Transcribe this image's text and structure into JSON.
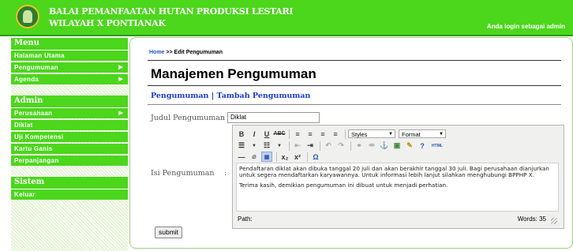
{
  "header": {
    "org_line1": "BALAI PEMANFAATAN HUTAN PRODUKSI LESTARI",
    "org_line2": "WILAYAH X PONTIANAK",
    "login_status": "Anda login sebagai admin"
  },
  "sidebar": {
    "sections": [
      {
        "title": "Menu",
        "items": [
          {
            "label": "Halaman Utama",
            "submenu": false
          },
          {
            "label": "Pengumuman",
            "submenu": true
          },
          {
            "label": "Agenda",
            "submenu": true
          }
        ]
      },
      {
        "title": "Admin",
        "items": [
          {
            "label": "Perusahaan",
            "submenu": true
          },
          {
            "label": "Diklat",
            "submenu": false
          },
          {
            "label": "Uji Kompetensi",
            "submenu": false
          },
          {
            "label": "Kartu Ganis",
            "submenu": false
          },
          {
            "label": "Perpanjangan",
            "submenu": false
          }
        ]
      },
      {
        "title": "Sistem",
        "items": [
          {
            "label": "Keluar",
            "submenu": false
          }
        ]
      }
    ]
  },
  "breadcrumb": {
    "home": "Home",
    "sep": " >> ",
    "current": "Edit Pengumuman"
  },
  "page_title": "Manajemen Pengumuman",
  "links": {
    "pengumuman": "Pengumuman",
    "sep": " | ",
    "tambah": "Tambah Pengumuman"
  },
  "form": {
    "judul_label": "Judul Pengumuman",
    "colon": ":",
    "judul_value": "Diklat",
    "isi_label": "Isi Pengumuman",
    "editor": {
      "styles_select": "Styles",
      "format_select": "Format",
      "html_button": "HTML",
      "paragraph1": "Pendaftaran diklat akan dibuka tanggal 20 juli dan akan berakhir tanggal 30 juli. Bagi perusahaan dianjurkan untuk segera mendaftarkan karyawannya. Untuk informasi lebih lanjut silahkan menghubungi BPPHP X.",
      "paragraph2": "Terima kasih, demikian pengumuman ini dibuat untuk menjadi perhatian.",
      "path_label": "Path:",
      "word_count": "Words: 35"
    },
    "submit_label": "submit"
  },
  "colors": {
    "brand_green": "#4cd61c",
    "link_blue": "#1a3cc8"
  }
}
